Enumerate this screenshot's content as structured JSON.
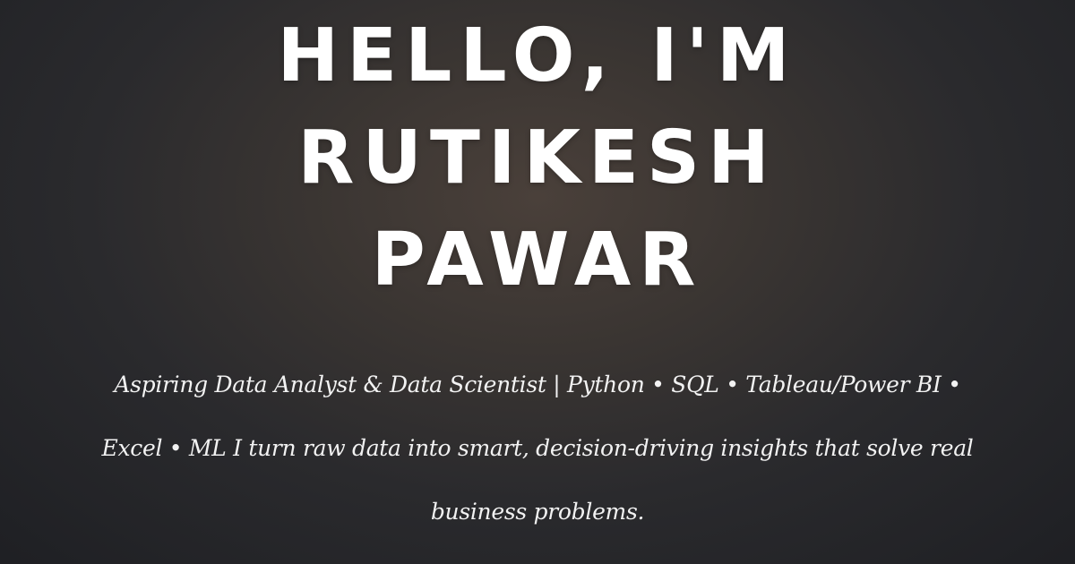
{
  "hero": {
    "title_lines": [
      "HELLO, I'M",
      "RUTIKESH",
      "PAWAR"
    ],
    "subtitle": "Aspiring Data Analyst & Data Scientist | Python • SQL • Tableau/Power BI • Excel • ML I turn raw data into smart, decision-driving insights that solve real business problems."
  }
}
